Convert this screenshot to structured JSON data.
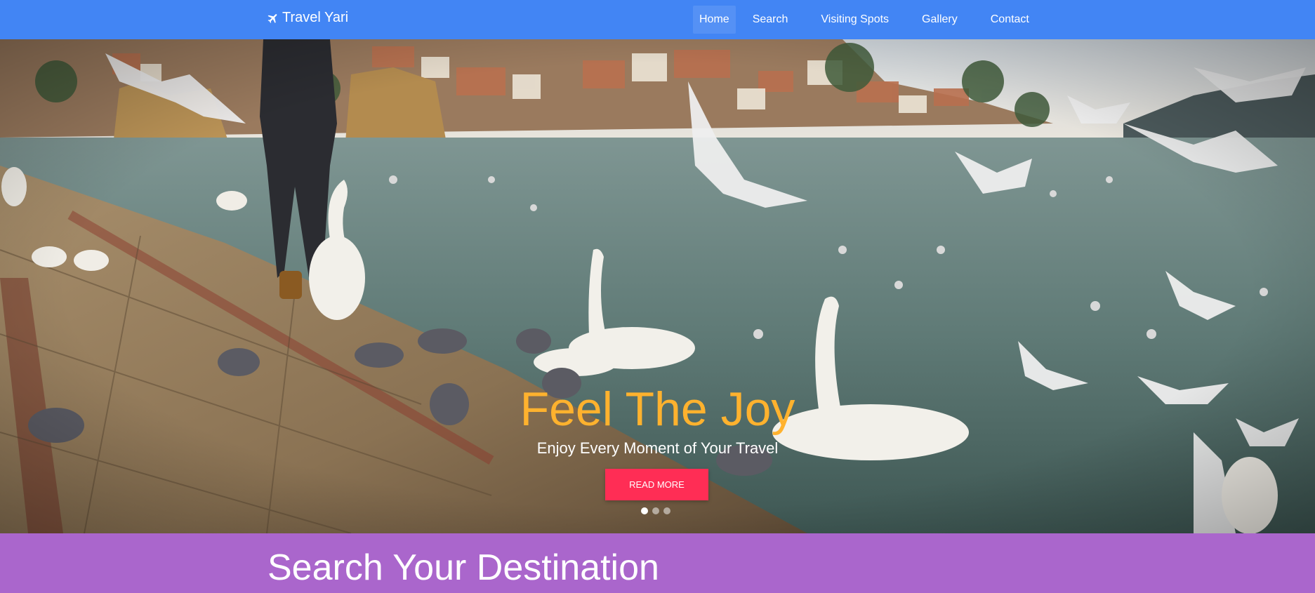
{
  "navbar": {
    "brand": "Travel Yari",
    "brand_icon": "plane-icon",
    "background": "#4285f4",
    "items": [
      {
        "label": "Home",
        "active": true
      },
      {
        "label": "Search",
        "active": false
      },
      {
        "label": "Visiting Spots",
        "active": false
      },
      {
        "label": "Gallery",
        "active": false
      },
      {
        "label": "Contact",
        "active": false
      }
    ]
  },
  "hero": {
    "title": "Feel The Joy",
    "title_color": "#ffb22e",
    "subtitle": "Enjoy Every Moment of Your Travel",
    "button_label": "READ MORE",
    "button_color": "#ff2d55",
    "carousel_count": 3,
    "carousel_active": 1
  },
  "search_section": {
    "title": "Search Your Destination",
    "background": "#aa66cc"
  }
}
